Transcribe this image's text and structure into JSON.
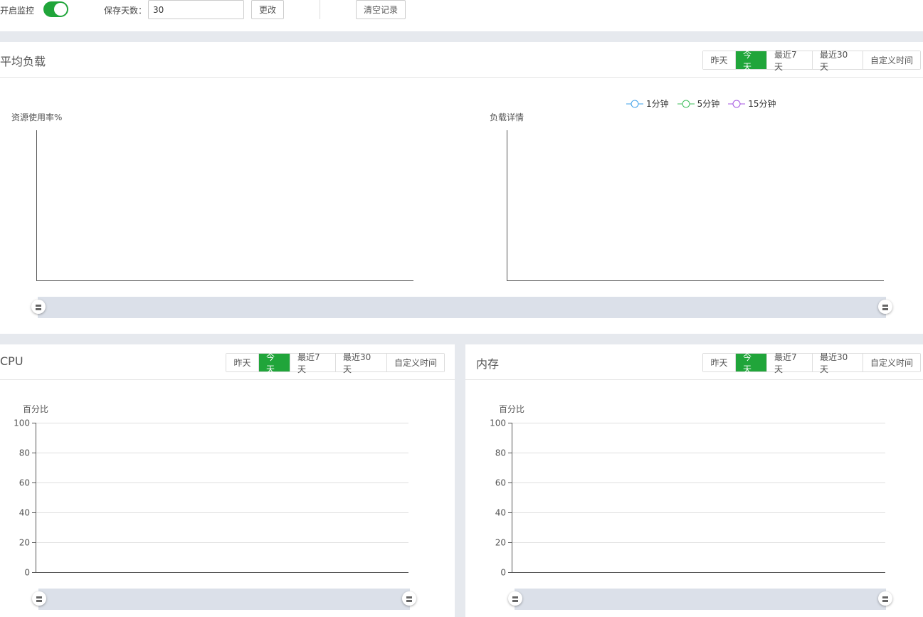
{
  "toolbar": {
    "monitor_label": "开启监控",
    "monitor_on": true,
    "days_label": "保存天数：",
    "days_value": "30",
    "change_button": "更改",
    "clear_button": "清空记录"
  },
  "tabs": [
    "昨天",
    "今天",
    "最近7天",
    "最近30天",
    "自定义时间"
  ],
  "active_tab": "今天",
  "load_panel": {
    "title": "平均负载",
    "left_chart_label": "资源使用率%",
    "right_chart_label": "负载详情",
    "legend": [
      {
        "name": "1分钟",
        "color": "#3ea0e8"
      },
      {
        "name": "5分钟",
        "color": "#3cbe5a"
      },
      {
        "name": "15分钟",
        "color": "#a455e0"
      }
    ]
  },
  "cpu_panel": {
    "title": "CPU",
    "ylabel": "百分比"
  },
  "mem_panel": {
    "title": "内存",
    "ylabel": "百分比"
  },
  "handle_glyph": "〓",
  "chart_data": [
    {
      "type": "line",
      "title": "",
      "ylabel": "资源使用率%",
      "series": []
    },
    {
      "type": "line",
      "title": "",
      "ylabel": "负载详情",
      "series": [
        {
          "name": "1分钟",
          "values": []
        },
        {
          "name": "5分钟",
          "values": []
        },
        {
          "name": "15分钟",
          "values": []
        }
      ]
    },
    {
      "type": "line",
      "title": "",
      "ylabel": "百分比",
      "ylim": [
        0,
        100
      ],
      "yticks": [
        "0",
        "20",
        "40",
        "60",
        "80",
        "100"
      ],
      "series": []
    },
    {
      "type": "line",
      "title": "",
      "ylabel": "百分比",
      "ylim": [
        0,
        100
      ],
      "yticks": [
        "0",
        "20",
        "40",
        "60",
        "80",
        "100"
      ],
      "series": []
    }
  ],
  "colors": {
    "accent": "#20a53a",
    "slider": "#dbe0e9"
  }
}
